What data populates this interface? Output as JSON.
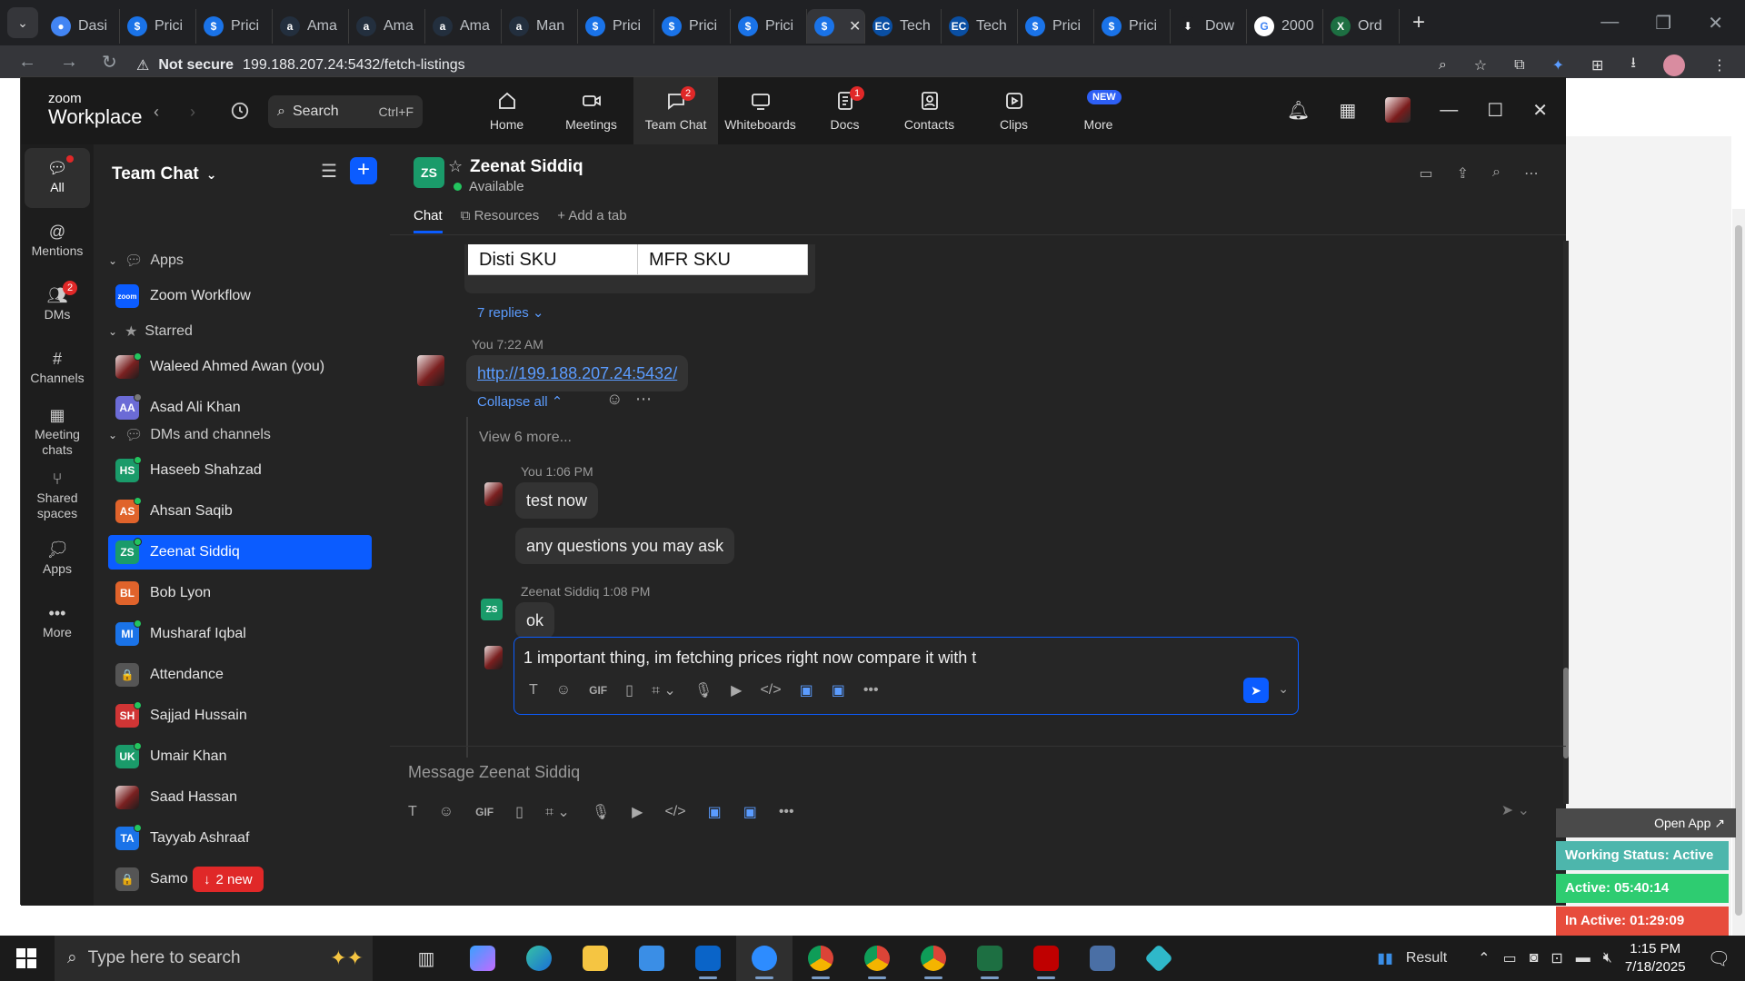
{
  "browser": {
    "tabs": [
      {
        "title": "Dasi",
        "icon": "chrome-tab-icon",
        "color": "#4285f4",
        "glyph": "●"
      },
      {
        "title": "Prici",
        "icon": "dollar-icon",
        "color": "#1a73e8",
        "glyph": "$"
      },
      {
        "title": "Prici",
        "icon": "dollar-icon",
        "color": "#1a73e8",
        "glyph": "$"
      },
      {
        "title": "Ama",
        "icon": "amazon-icon",
        "color": "#232f3e",
        "glyph": "a"
      },
      {
        "title": "Ama",
        "icon": "amazon-icon",
        "color": "#232f3e",
        "glyph": "a"
      },
      {
        "title": "Ama",
        "icon": "amazon-icon",
        "color": "#232f3e",
        "glyph": "a"
      },
      {
        "title": "Man",
        "icon": "amazon-icon",
        "color": "#232f3e",
        "glyph": "a"
      },
      {
        "title": "Prici",
        "icon": "dollar-icon",
        "color": "#1a73e8",
        "glyph": "$"
      },
      {
        "title": "Prici",
        "icon": "dollar-icon",
        "color": "#1a73e8",
        "glyph": "$"
      },
      {
        "title": "Prici",
        "icon": "dollar-icon",
        "color": "#1a73e8",
        "glyph": "$"
      },
      {
        "title": "",
        "icon": "dollar-icon",
        "color": "#1a73e8",
        "glyph": "$",
        "active": true
      },
      {
        "title": "Tech",
        "icon": "ec-icon",
        "color": "#0a4fa3",
        "glyph": "EC"
      },
      {
        "title": "Tech",
        "icon": "ec-icon",
        "color": "#0a4fa3",
        "glyph": "EC"
      },
      {
        "title": "Prici",
        "icon": "dollar-icon",
        "color": "#1a73e8",
        "glyph": "$"
      },
      {
        "title": "Prici",
        "icon": "dollar-icon",
        "color": "#1a73e8",
        "glyph": "$"
      },
      {
        "title": "Dow",
        "icon": "download-icon",
        "color": "#202124",
        "glyph": "⬇"
      },
      {
        "title": "2000",
        "icon": "google-icon",
        "color": "#ffffff",
        "glyph": "G"
      },
      {
        "title": "Ord",
        "icon": "excel-icon",
        "color": "#1d6f42",
        "glyph": "X"
      }
    ],
    "not_secure": "Not secure",
    "url": "199.188.207.24:5432/fetch-listings"
  },
  "zoom": {
    "logo_top": "zoom",
    "logo_bottom": "Workplace",
    "search_label": "Search",
    "search_shortcut": "Ctrl+F",
    "nav": [
      {
        "label": "Home",
        "icon": "home-icon"
      },
      {
        "label": "Meetings",
        "icon": "video-icon"
      },
      {
        "label": "Team Chat",
        "icon": "chat-icon",
        "badge": "2",
        "active": true
      },
      {
        "label": "Whiteboards",
        "icon": "whiteboard-icon"
      },
      {
        "label": "Docs",
        "icon": "docs-icon",
        "badge": "1"
      },
      {
        "label": "Contacts",
        "icon": "contacts-icon"
      },
      {
        "label": "Clips",
        "icon": "clips-icon"
      },
      {
        "label": "More",
        "icon": "more-icon",
        "new": "NEW"
      }
    ]
  },
  "rail": [
    {
      "label": "All",
      "active": true
    },
    {
      "label": "Mentions"
    },
    {
      "label": "DMs",
      "badge": "2"
    },
    {
      "label": "Channels"
    },
    {
      "label": "Meeting chats"
    },
    {
      "label": "Shared spaces"
    },
    {
      "label": "Apps"
    },
    {
      "label": "More"
    }
  ],
  "sidebar": {
    "title": "Team Chat",
    "sections": {
      "apps": "Apps",
      "starred": "Starred",
      "dms": "DMs and channels"
    },
    "apps": [
      {
        "name": "Zoom Workflow",
        "initials": "zoom",
        "color": "#0b5cff"
      }
    ],
    "starred": [
      {
        "name": "Waleed Ahmed Awan (you)",
        "photo": true,
        "status": "on"
      },
      {
        "name": "Asad Ali Khan",
        "initials": "AA",
        "color": "#6b6bd6",
        "status": "off"
      }
    ],
    "dms": [
      {
        "name": "Haseeb Shahzad",
        "initials": "HS",
        "color": "#1a9b6a",
        "status": "on"
      },
      {
        "name": "Ahsan Saqib",
        "initials": "AS",
        "color": "#e0632b",
        "status": "on"
      },
      {
        "name": "Zeenat Siddiq",
        "initials": "ZS",
        "color": "#1a9b6a",
        "status": "on",
        "selected": true
      },
      {
        "name": "Bob Lyon",
        "initials": "BL",
        "color": "#e0632b",
        "status": "none"
      },
      {
        "name": "Musharaf Iqbal",
        "initials": "MI",
        "color": "#1a73e8",
        "status": "on"
      },
      {
        "name": "Attendance",
        "initials": "🔒",
        "color": "#555555",
        "status": "none"
      },
      {
        "name": "Sajjad Hussain",
        "initials": "SH",
        "color": "#d03535",
        "status": "on"
      },
      {
        "name": "Umair Khan",
        "initials": "UK",
        "color": "#1a9b6a",
        "status": "on"
      },
      {
        "name": "Saad Hassan",
        "initials": "",
        "color": "#8a4a4a",
        "photo": true,
        "status": "none"
      },
      {
        "name": "Tayyab Ashraaf",
        "initials": "TA",
        "color": "#1a73e8",
        "status": "on"
      },
      {
        "name": "Samo",
        "initials": "🔒",
        "color": "#555555",
        "status": "none"
      }
    ],
    "new_pill": "2 new"
  },
  "chat": {
    "contact_initials": "ZS",
    "contact_name": "Zeenat Siddiq",
    "contact_status": "Available",
    "tabs": {
      "chat": "Chat",
      "resources": "Resources",
      "add": "Add a tab"
    },
    "table_headers": [
      "Disti SKU",
      "MFR SKU"
    ],
    "replies_1": "7 replies",
    "msg1_header": "You 7:22 AM",
    "msg1_link": "http://199.188.207.24:5432/",
    "collapse_all": "Collapse all",
    "view_more": "View 6 more...",
    "msg2_header": "You 1:06 PM",
    "msg2_a": "test now",
    "msg2_b": "any questions you may ask",
    "msg3_header": "Zeenat Siddiq 1:08 PM",
    "msg3": "ok",
    "reply_draft": "1 important thing, im fetching prices right now compare it with t",
    "composer_placeholder": "Message Zeenat Siddiq"
  },
  "widget": {
    "open_app": "Open App ↗",
    "working": "Working Status: Active",
    "active": "Active: 05:40:14",
    "inactive": "In Active: 01:29:09",
    "colors": {
      "working": "#4db6ac",
      "active": "#2ecc71",
      "inactive": "#e74c3c"
    }
  },
  "taskbar": {
    "search_placeholder": "Type here to search",
    "weather": "Result",
    "time": "1:15 PM",
    "date": "7/18/2025"
  }
}
